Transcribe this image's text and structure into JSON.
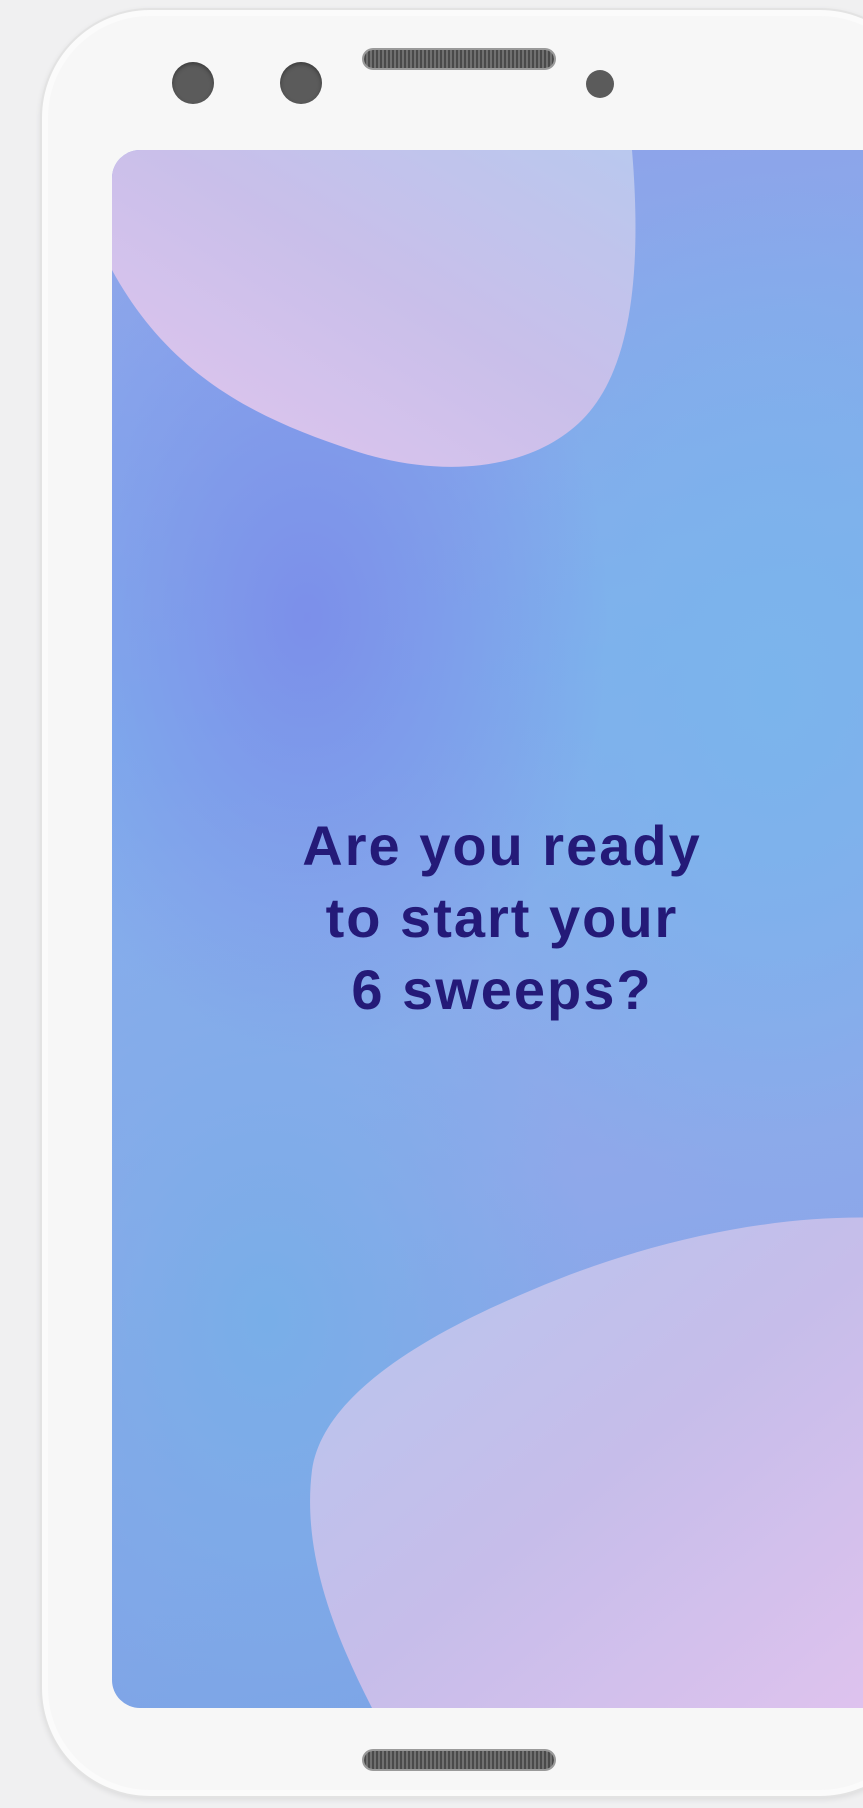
{
  "prompt": {
    "lines": [
      "Are you ready",
      "to start your",
      "6 sweeps?"
    ]
  },
  "colors": {
    "text": "#241a78",
    "device_body": "#f7f7f7",
    "screen_blue": "#7fb0ec",
    "blob_pink": "#dcc3ec"
  },
  "icons": [
    "front-camera-icon",
    "earpiece-speaker-icon",
    "proximity-sensor-icon",
    "bottom-speaker-icon"
  ]
}
